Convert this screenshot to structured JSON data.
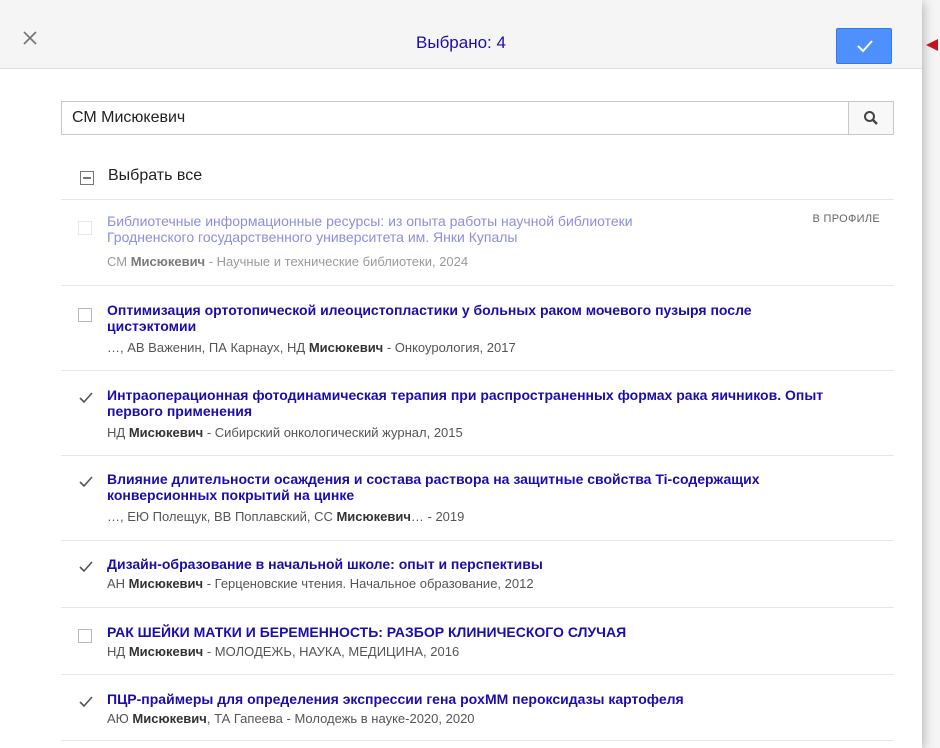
{
  "header": {
    "title": "Выбрано: 4",
    "close_icon": "close-icon",
    "confirm_icon": "checkmark-icon"
  },
  "search": {
    "value": "СМ Мисюкевич",
    "placeholder": "",
    "icon": "search-icon"
  },
  "select_all": {
    "label": "Выбрать все",
    "state": "indeterminate"
  },
  "items": [
    {
      "title_line1": "Библиотечные информационные ресурсы: из опыта работы научной библиотеки",
      "title_line2": "Гродненского государственного университета им. Янки Купалы",
      "authors_pre": "СМ ",
      "author_bold": "Мисюкевич",
      "authors_post": " - Научные и технические библиотеки, 2024",
      "badge": "В ПРОФИЛЕ",
      "checked": false,
      "disabled": true
    },
    {
      "title_line1": "Оптимизация ортотопической илеоцистопластики у больных раком мочевого пузыря после",
      "title_line2": "цистэктомии",
      "authors_pre": "…, АВ Важенин, ПА Карнаух, НД ",
      "author_bold": "Мисюкевич",
      "authors_post": " - Онкоурология, 2017",
      "checked": false
    },
    {
      "title_line1": "Интраоперационная фотодинамическая терапия при распространенных формах рака яичников. Опыт",
      "title_line2": "первого применения",
      "authors_pre": "НД ",
      "author_bold": "Мисюкевич",
      "authors_post": " - Сибирский онкологический журнал, 2015",
      "checked": true
    },
    {
      "title_line1": "Влияние длительности осаждения и состава раствора на защитные свойства Ti-содержащих",
      "title_line2": "конверсионных покрытий на цинке",
      "authors_pre": "…, ЕЮ Полещук, ВВ Поплавский, СС ",
      "author_bold": "Мисюкевич",
      "authors_post": "… - 2019",
      "checked": true
    },
    {
      "title_line1": "Дизайн-образование в начальной школе: опыт и перспективы",
      "title_line2": "",
      "authors_pre": "АН ",
      "author_bold": "Мисюкевич",
      "authors_post": " - Герценовские чтения. Начальное образование, 2012",
      "checked": true
    },
    {
      "title_line1": "РАК ШЕЙКИ МАТКИ И БЕРЕМЕННОСТЬ: РАЗБОР КЛИНИЧЕСКОГО СЛУЧАЯ",
      "title_line2": "",
      "authors_pre": "НД ",
      "author_bold": "Мисюкевич",
      "authors_post": " - МОЛОДЕЖЬ, НАУКА, МЕДИЦИНА, 2016",
      "checked": false
    },
    {
      "title_line1": "ПЦР-праймеры для определения экспрессии гена poxMM пероксидазы картофеля",
      "title_line2": "",
      "authors_pre": "АЮ ",
      "author_bold": "Мисюкевич",
      "authors_post": ", ТА Гапеева - Молодежь в науке-2020, 2020",
      "checked": true
    }
  ],
  "colors": {
    "accent": "#4d90fe",
    "link": "#1a0dab",
    "pointer": "#c0161e"
  }
}
